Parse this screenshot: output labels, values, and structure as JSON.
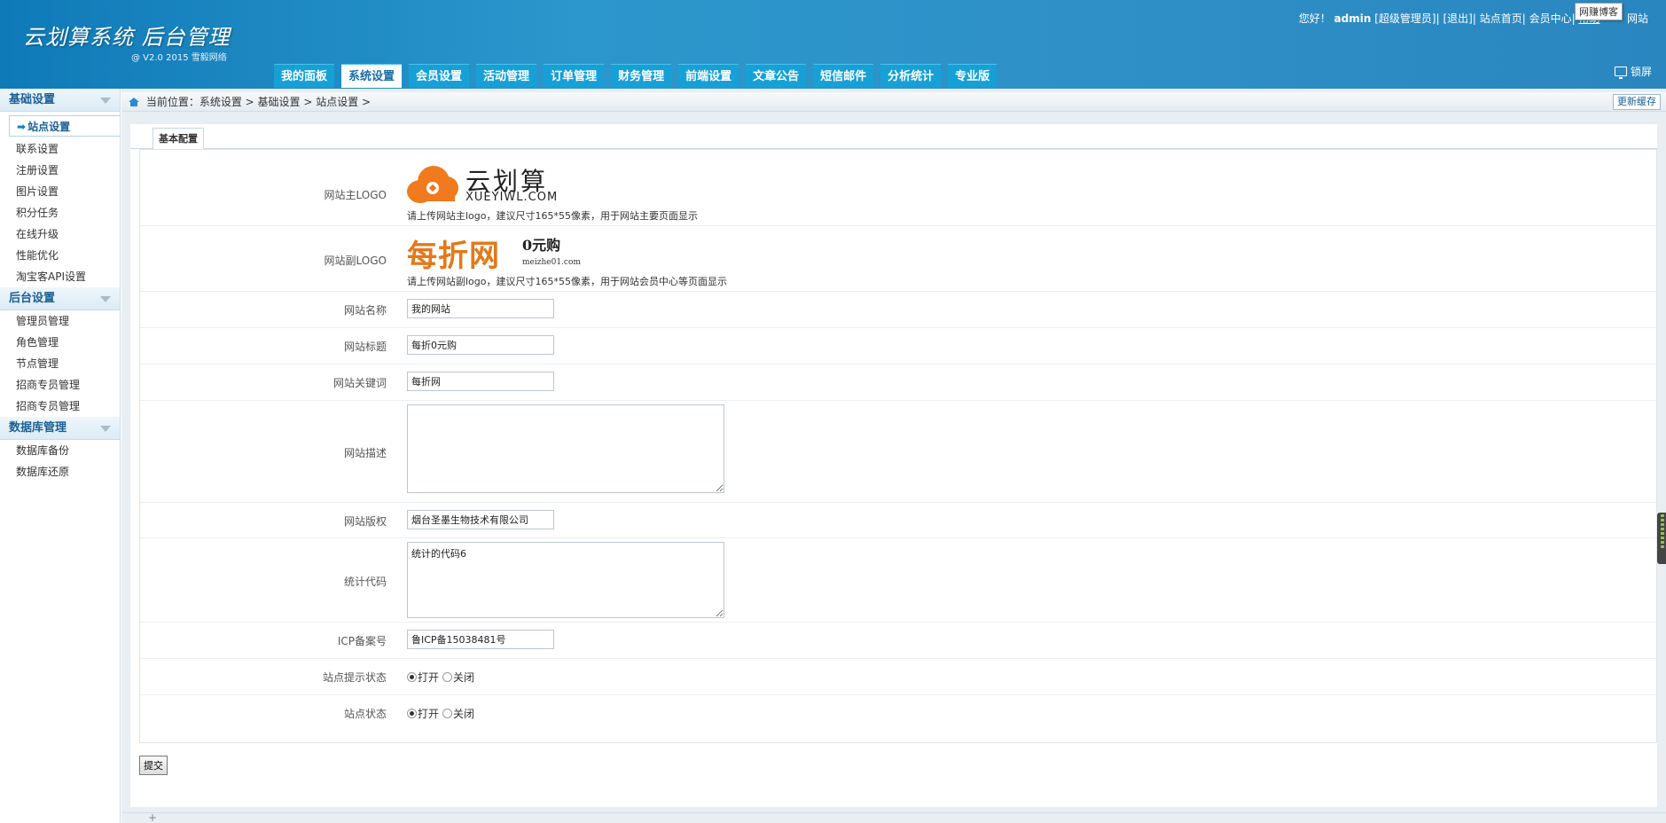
{
  "brand": {
    "title": "云划算系统 后台管理",
    "version": "@ V2.0 2015 雪毅网络"
  },
  "topbar": {
    "greeting": "您好！",
    "user": "admin",
    "role": "[超级管理员]",
    "logout": "[退出]",
    "site_home": "站点首页",
    "member_center": "会员中心",
    "help": "帮助",
    "trailing": "网站",
    "tooltip": "网赚博客"
  },
  "nav": {
    "tabs": [
      {
        "label": "我的面板",
        "active": false
      },
      {
        "label": "系统设置",
        "active": true
      },
      {
        "label": "会员设置",
        "active": false
      },
      {
        "label": "活动管理",
        "active": false
      },
      {
        "label": "订单管理",
        "active": false
      },
      {
        "label": "财务管理",
        "active": false
      },
      {
        "label": "前端设置",
        "active": false
      },
      {
        "label": "文章公告",
        "active": false
      },
      {
        "label": "短信邮件",
        "active": false
      },
      {
        "label": "分析统计",
        "active": false
      },
      {
        "label": "专业版",
        "active": false
      }
    ],
    "lock_label": "锁屏"
  },
  "sidebar": {
    "groups": [
      {
        "title": "基础设置",
        "items": [
          "站点设置",
          "联系设置",
          "注册设置",
          "图片设置",
          "积分任务",
          "在线升级",
          "性能优化",
          "淘宝客API设置"
        ],
        "active_index": 0
      },
      {
        "title": "后台设置",
        "items": [
          "管理员管理",
          "角色管理",
          "节点管理",
          "招商专员管理",
          "招商专员管理"
        ]
      },
      {
        "title": "数据库管理",
        "items": [
          "数据库备份",
          "数据库还原"
        ]
      }
    ]
  },
  "breadcrumb": {
    "text": "当前位置：系统设置 > 基础设置 > 站点设置 >",
    "refresh": "更新缓存"
  },
  "tab": {
    "label": "基本配置"
  },
  "form": {
    "logo_main": {
      "label": "网站主LOGO",
      "logo_text": "云划算",
      "logo_sub": "XUEYIWL.COM",
      "hint": "请上传网站主logo，建议尺寸165*55像素，用于网站主要页面显示"
    },
    "logo_sub": {
      "label": "网站副LOGO",
      "logo_text": "每折网",
      "logo_promo": "0元购",
      "logo_domain": "meizhe01.com",
      "hint": "请上传网站副logo，建议尺寸165*55像素，用于网站会员中心等页面显示"
    },
    "site_name": {
      "label": "网站名称",
      "value": "我的网站"
    },
    "site_title": {
      "label": "网站标题",
      "value": "每折0元购"
    },
    "site_keywords": {
      "label": "网站关键词",
      "value": "每折网"
    },
    "site_description": {
      "label": "网站描述",
      "value": ""
    },
    "copyright": {
      "label": "网站版权",
      "value": "烟台圣墨生物技术有限公司"
    },
    "stat_code": {
      "label": "统计代码",
      "value": "统计的代码6"
    },
    "icp": {
      "label": "ICP备案号",
      "value": "鲁ICP备15038481号"
    },
    "tip_status": {
      "label": "站点提示状态",
      "on": "打开",
      "off": "关闭",
      "selected": "on"
    },
    "site_status": {
      "label": "站点状态",
      "on": "打开",
      "off": "关闭",
      "selected": "on"
    }
  },
  "submit_label": "提交",
  "bottom_plus": "+",
  "colors": {
    "header": "#2a8fc7",
    "nav_tab": "#16a0d6",
    "logo_orange": "#f07a1d",
    "link_blue": "#1b5f96"
  }
}
